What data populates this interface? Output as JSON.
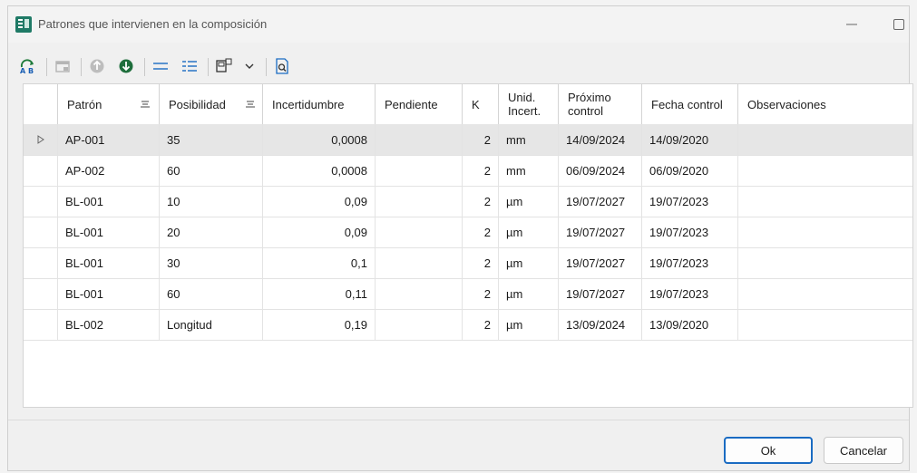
{
  "window": {
    "title": "Patrones que intervienen en la composición"
  },
  "toolbar": {
    "buttons": [
      {
        "icon": "text-format-icon"
      },
      {
        "icon": "window-icon"
      },
      {
        "icon": "move-up-icon"
      },
      {
        "icon": "move-down-icon"
      },
      {
        "icon": "list-collapse-icon"
      },
      {
        "icon": "list-expand-icon"
      },
      {
        "icon": "export-icon"
      },
      {
        "icon": "dropdown-chevron-icon"
      },
      {
        "icon": "preview-icon"
      }
    ]
  },
  "table": {
    "columns": [
      "Patrón",
      "Posibilidad",
      "Incertidumbre",
      "Pendiente",
      "K",
      "Unid. Incert.",
      "Próximo control",
      "Fecha control",
      "Observaciones"
    ],
    "rows": [
      {
        "patron": "AP-001",
        "posibilidad": "35",
        "incertidumbre": "0,0008",
        "pendiente": "",
        "k": "2",
        "unid": "mm",
        "proximo": "14/09/2024",
        "fecha": "14/09/2020",
        "obs": ""
      },
      {
        "patron": "AP-002",
        "posibilidad": "60",
        "incertidumbre": "0,0008",
        "pendiente": "",
        "k": "2",
        "unid": "mm",
        "proximo": "06/09/2024",
        "fecha": "06/09/2020",
        "obs": ""
      },
      {
        "patron": "BL-001",
        "posibilidad": "10",
        "incertidumbre": "0,09",
        "pendiente": "",
        "k": "2",
        "unid": "µm",
        "proximo": "19/07/2027",
        "fecha": "19/07/2023",
        "obs": ""
      },
      {
        "patron": "BL-001",
        "posibilidad": "20",
        "incertidumbre": "0,09",
        "pendiente": "",
        "k": "2",
        "unid": "µm",
        "proximo": "19/07/2027",
        "fecha": "19/07/2023",
        "obs": ""
      },
      {
        "patron": "BL-001",
        "posibilidad": "30",
        "incertidumbre": "0,1",
        "pendiente": "",
        "k": "2",
        "unid": "µm",
        "proximo": "19/07/2027",
        "fecha": "19/07/2023",
        "obs": ""
      },
      {
        "patron": "BL-001",
        "posibilidad": "60",
        "incertidumbre": "0,11",
        "pendiente": "",
        "k": "2",
        "unid": "µm",
        "proximo": "19/07/2027",
        "fecha": "19/07/2023",
        "obs": ""
      },
      {
        "patron": "BL-002",
        "posibilidad": "Longitud",
        "incertidumbre": "0,19",
        "pendiente": "",
        "k": "2",
        "unid": "µm",
        "proximo": "13/09/2024",
        "fecha": "13/09/2020",
        "obs": ""
      }
    ]
  },
  "footer": {
    "ok_label": "Ok",
    "cancel_label": "Cancelar"
  },
  "colors": {
    "accent": "#1a6bc2",
    "selected_row": "#e6e6e6",
    "toolbar_green": "#1e7a3a"
  }
}
